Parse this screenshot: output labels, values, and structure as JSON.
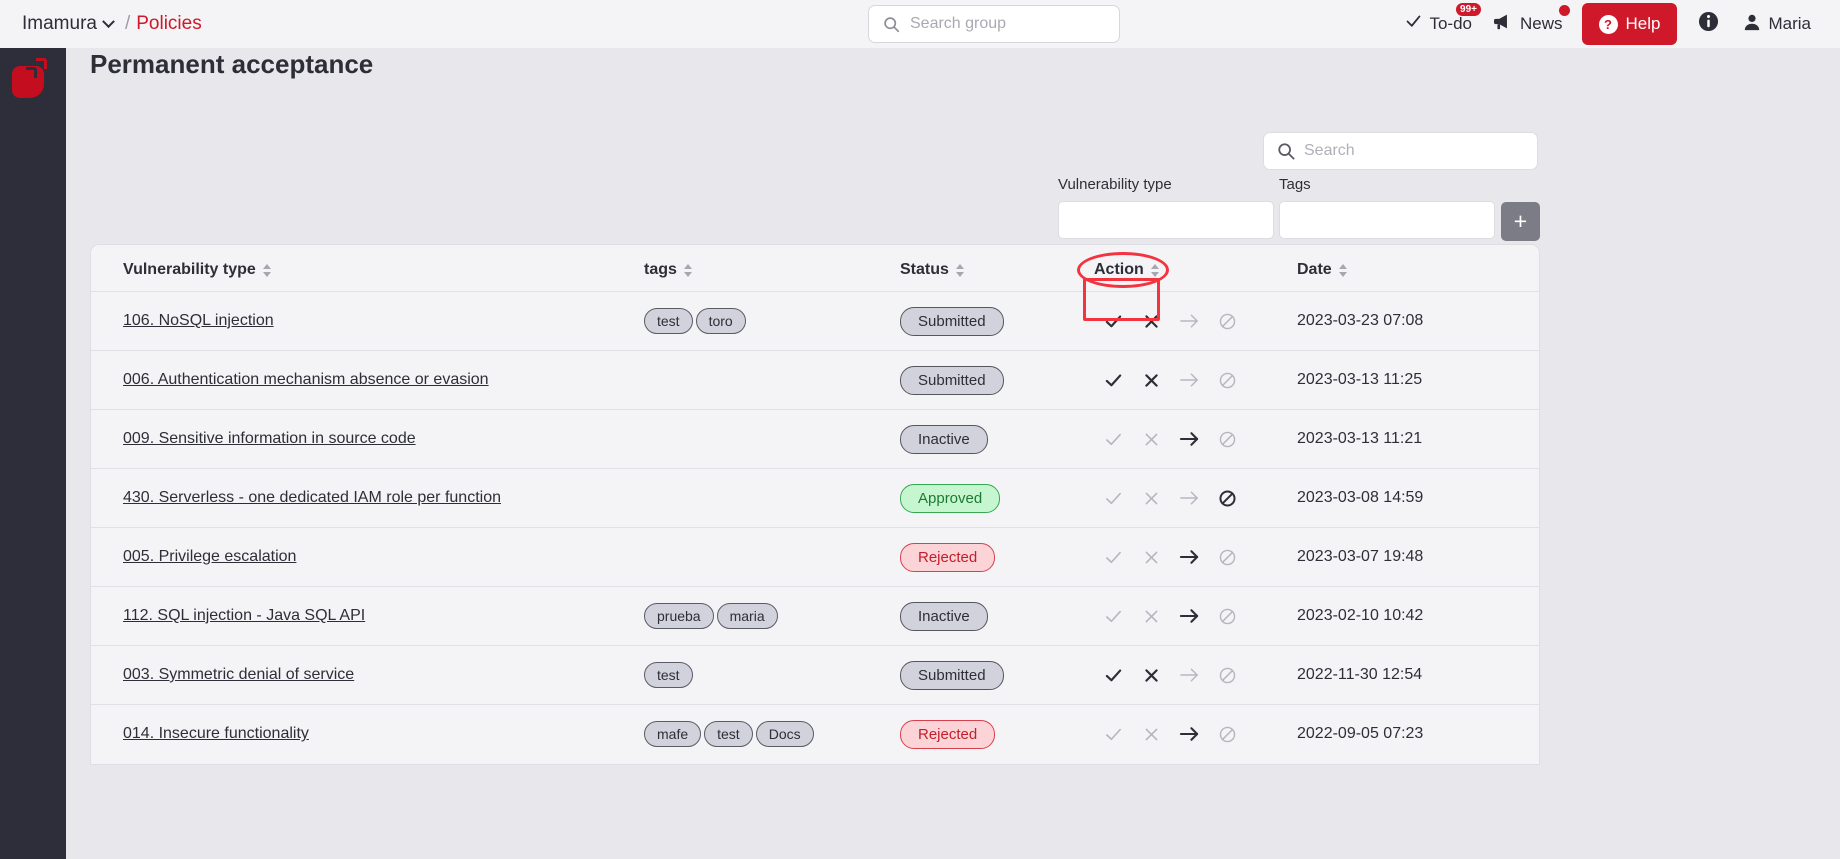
{
  "topbar": {
    "org_label": "Imamura",
    "separator": "/",
    "crumb_label": "Policies",
    "group_search_placeholder": "Search group",
    "nav": {
      "todo_label": "To-do",
      "todo_badge": "99+",
      "news_label": "News",
      "help_label": "Help",
      "help_mark": "?",
      "user_label": "Maria"
    }
  },
  "page": {
    "title": "Permanent acceptance"
  },
  "filters": {
    "search_placeholder": "Search",
    "vulnerability_type_label": "Vulnerability type",
    "vulnerability_type_value": "",
    "tags_label": "Tags",
    "tags_value": "",
    "add_button_label": "+"
  },
  "table": {
    "headers": {
      "vulnerability_type": "Vulnerability type",
      "tags": "tags",
      "status": "Status",
      "action": "Action",
      "date": "Date"
    },
    "rows": [
      {
        "name": "106. NoSQL injection",
        "tags": [
          "test",
          "toro"
        ],
        "status": "Submitted",
        "status_kind": "submitted",
        "actions": {
          "approve": true,
          "reject": true,
          "forward": false,
          "block": false
        },
        "date": "2023-03-23 07:08"
      },
      {
        "name": "006. Authentication mechanism absence or evasion",
        "tags": [],
        "status": "Submitted",
        "status_kind": "submitted",
        "actions": {
          "approve": true,
          "reject": true,
          "forward": false,
          "block": false
        },
        "date": "2023-03-13 11:25"
      },
      {
        "name": "009. Sensitive information in source code",
        "tags": [],
        "status": "Inactive",
        "status_kind": "inactive",
        "actions": {
          "approve": false,
          "reject": false,
          "forward": true,
          "block": false
        },
        "date": "2023-03-13 11:21"
      },
      {
        "name": "430. Serverless - one dedicated IAM role per function",
        "tags": [],
        "status": "Approved",
        "status_kind": "approved",
        "actions": {
          "approve": false,
          "reject": false,
          "forward": false,
          "block": true
        },
        "date": "2023-03-08 14:59"
      },
      {
        "name": "005. Privilege escalation",
        "tags": [],
        "status": "Rejected",
        "status_kind": "rejected",
        "actions": {
          "approve": false,
          "reject": false,
          "forward": true,
          "block": false
        },
        "date": "2023-03-07 19:48"
      },
      {
        "name": "112. SQL injection - Java SQL API",
        "tags": [
          "prueba",
          "maria"
        ],
        "status": "Inactive",
        "status_kind": "inactive",
        "actions": {
          "approve": false,
          "reject": false,
          "forward": true,
          "block": false
        },
        "date": "2023-02-10 10:42"
      },
      {
        "name": "003. Symmetric denial of service",
        "tags": [
          "test"
        ],
        "status": "Submitted",
        "status_kind": "submitted",
        "actions": {
          "approve": true,
          "reject": true,
          "forward": false,
          "block": false
        },
        "date": "2022-11-30 12:54"
      },
      {
        "name": "014. Insecure functionality",
        "tags": [
          "mafe",
          "test",
          "Docs"
        ],
        "status": "Rejected",
        "status_kind": "rejected",
        "actions": {
          "approve": false,
          "reject": false,
          "forward": true,
          "block": false
        },
        "date": "2022-09-05 07:23"
      }
    ]
  },
  "annotations": {
    "action_header_ellipse": true,
    "first_row_action_box": true,
    "highlight_color": "#f5333f"
  },
  "colors": {
    "brand_red": "#cf1829",
    "sidebar_bg": "#2e2e3a",
    "page_bg": "#e8e8ec",
    "card_bg": "#f4f4f6",
    "approved_green": "#1d7a33",
    "rejected_red": "#c01f2c"
  }
}
